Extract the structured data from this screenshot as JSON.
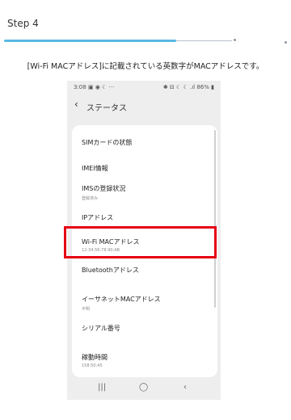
{
  "header": {
    "step_title": "Step 4"
  },
  "progress": {
    "fraction": 0.61
  },
  "caption": "[Wi-Fi MACアドレス]に記載されている英数字がMACアドレスです。",
  "status_bar": {
    "time": "3:08 ▣ ◉ ☾ ···",
    "right": "✱ ⊟ ☾ ☾ .ıl 86% ▮"
  },
  "app": {
    "back": "‹",
    "title": "ステータス"
  },
  "rows": [
    {
      "label": "SIMカードの状態",
      "sub": ""
    },
    {
      "label": "IMEI情報",
      "sub": ""
    },
    {
      "label": "IMSの登録状況",
      "sub": "登録済み"
    },
    {
      "label": "IPアドレス",
      "sub": ""
    },
    {
      "label": "Wi-Fi MACアドレス",
      "sub": "12:34:56:78:90:AB"
    },
    {
      "label": "Bluetoothアドレス",
      "sub": ""
    },
    {
      "label": "イーサネットMACアドレス",
      "sub": "不明"
    },
    {
      "label": "シリアル番号",
      "sub": ""
    },
    {
      "label": "稼動時間",
      "sub": "158:50:45"
    }
  ],
  "nav": {
    "recent": "|||",
    "home": "◯",
    "back": "‹"
  },
  "colors": {
    "highlight": "#e60012",
    "progress_fill": "#58b8e4"
  }
}
